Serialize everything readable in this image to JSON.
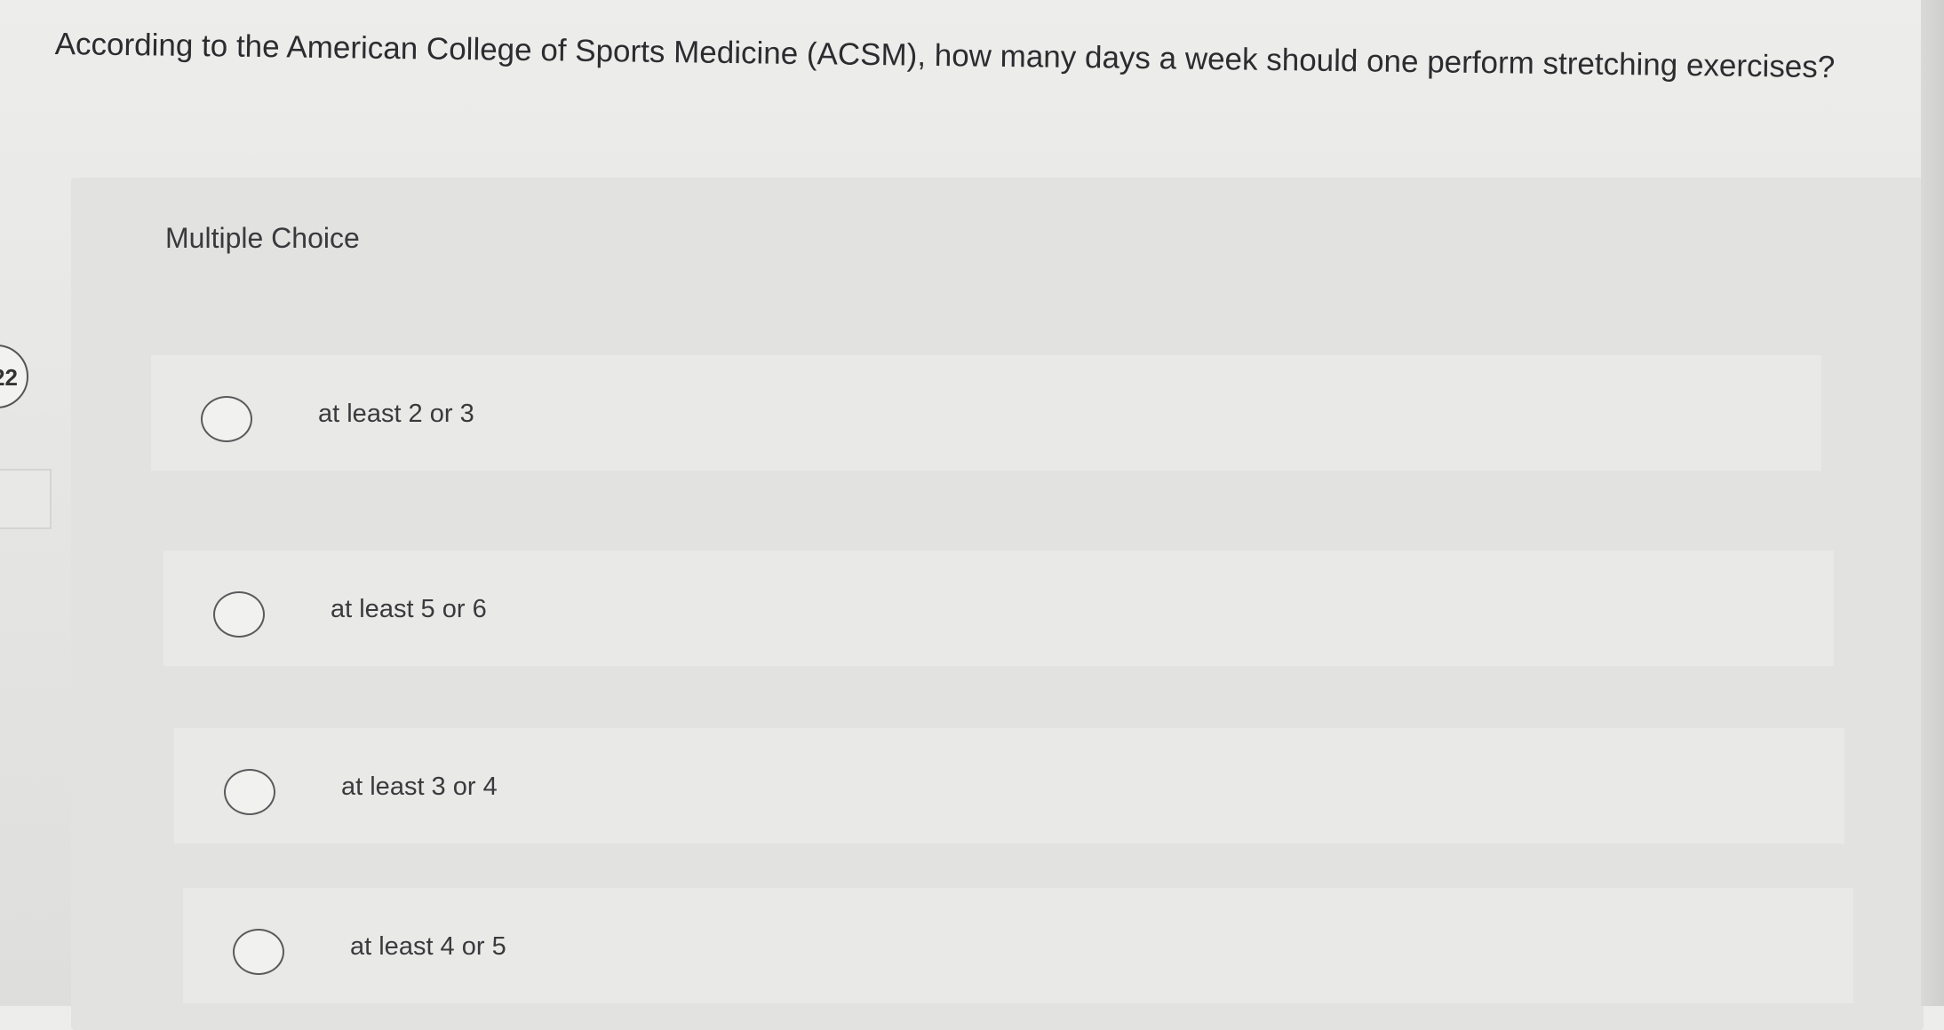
{
  "question_number": "22",
  "question": "According to the American College of Sports Medicine (ACSM), how many days a week should one perform stretching exercises?",
  "answer_type": "Multiple Choice",
  "choices": [
    {
      "label": "at least 2 or 3",
      "selected": false
    },
    {
      "label": "at least 5 or 6",
      "selected": false
    },
    {
      "label": "at least 3 or 4",
      "selected": false
    },
    {
      "label": "at least 4 or 5",
      "selected": false
    }
  ]
}
